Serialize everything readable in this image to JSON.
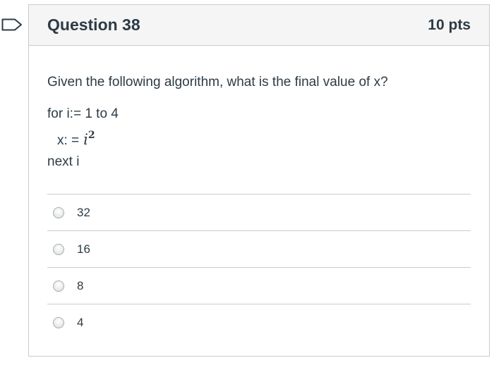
{
  "question": {
    "title": "Question 38",
    "points": "10 pts",
    "prompt": "Given the following algorithm, what is the final value of x?",
    "algorithm": {
      "line1": "for i:= 1 to 4",
      "line2_prefix": "x: =",
      "line2_var": "i",
      "line2_exp": "2",
      "line3": "next i"
    }
  },
  "answers": [
    {
      "label": "32",
      "selected": false
    },
    {
      "label": "16",
      "selected": false
    },
    {
      "label": "8",
      "selected": false
    },
    {
      "label": "4",
      "selected": false
    }
  ],
  "icons": {
    "flag": "bookmark-flag-icon",
    "radio": "radio-button-icon"
  },
  "colors": {
    "text": "#2d3b45",
    "border": "#c7cdd1",
    "header_bg": "#f5f5f5",
    "flag": "#2d3b45"
  }
}
